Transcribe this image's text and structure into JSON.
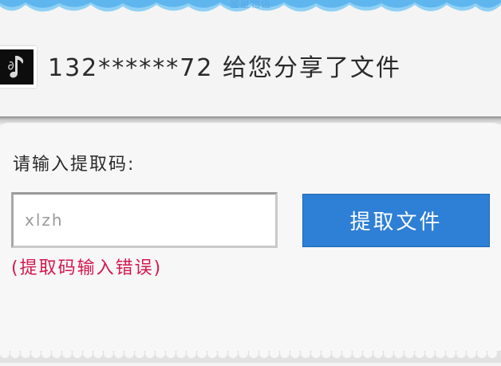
{
  "banner": {
    "text": "星星物语",
    "color": "#5aa8e6"
  },
  "share": {
    "avatar_icon": "music-note-icon",
    "message": "132******72 给您分享了文件"
  },
  "extract": {
    "prompt_label": "请输入提取码:",
    "code_value": "xlzh",
    "button_label": "提取文件",
    "error_message": "(提取码输入错误)"
  },
  "colors": {
    "accent": "#2e7fd6",
    "error": "#d4174e",
    "background": "#f4f4f4"
  }
}
